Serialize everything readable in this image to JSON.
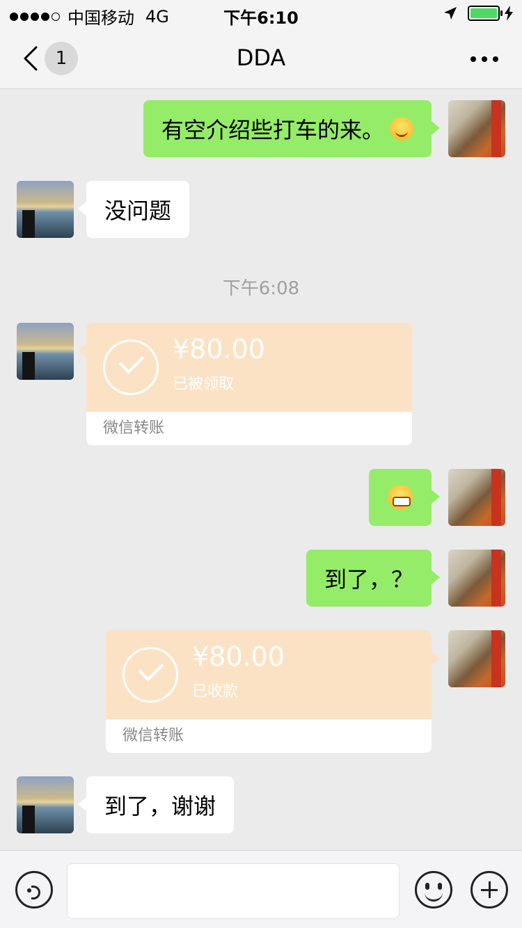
{
  "status_bar": {
    "carrier": "中国移动",
    "network": "4G",
    "time": "下午6:10",
    "battery_level": 1.0
  },
  "nav": {
    "badge_count": "1",
    "title": "DDA"
  },
  "messages": [
    {
      "side": "right",
      "type": "text",
      "text": "有空介绍些打车的来。",
      "emoji": "smile-emoji"
    },
    {
      "side": "left",
      "type": "text",
      "text": "没问题"
    },
    {
      "type": "timestamp",
      "text": "下午6:08"
    },
    {
      "side": "left",
      "type": "transfer",
      "amount": "¥80.00",
      "status": "已被领取",
      "footer": "微信转账"
    },
    {
      "side": "right",
      "type": "emoji",
      "emoji": "grin-emoji"
    },
    {
      "side": "right",
      "type": "text",
      "text": "到了，？"
    },
    {
      "side": "right",
      "type": "transfer",
      "amount": "¥80.00",
      "status": "已收款",
      "footer": "微信转账"
    },
    {
      "side": "left",
      "type": "text",
      "text": "到了，谢谢"
    }
  ],
  "input_bar": {
    "placeholder": ""
  },
  "colors": {
    "chat_bg": "#ebebeb",
    "green_bubble": "#95ec69",
    "transfer_bg": "#fce2c4"
  }
}
